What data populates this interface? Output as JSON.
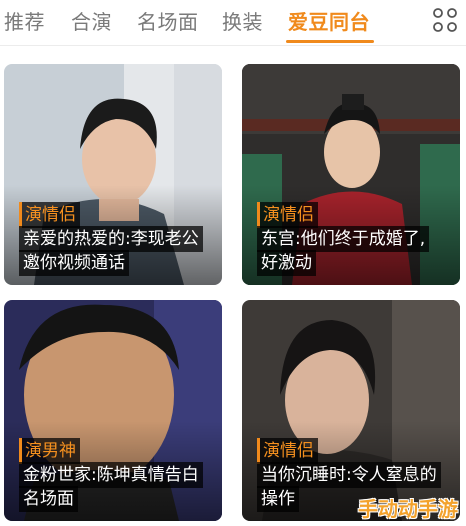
{
  "tabs": [
    {
      "label": "推荐",
      "active": false
    },
    {
      "label": "合演",
      "active": false
    },
    {
      "label": "名场面",
      "active": false
    },
    {
      "label": "换装",
      "active": false
    },
    {
      "label": "爱豆同台",
      "active": true
    }
  ],
  "grid_icon": "grid-dots-icon",
  "accent_color": "#f08a1c",
  "cards": [
    {
      "tag": "演情侣",
      "lines": [
        "亲爱的热爱的:李现老公",
        "邀你视频通话"
      ]
    },
    {
      "tag": "演情侣",
      "lines": [
        "东宫:他们终于成婚了,",
        "好激动"
      ]
    },
    {
      "tag": "演男神",
      "lines": [
        "金粉世家:陈坤真情告白",
        "名场面"
      ]
    },
    {
      "tag": "演情侣",
      "lines": [
        "当你沉睡时:令人窒息的",
        "操作"
      ]
    }
  ],
  "watermark": "手动动手游"
}
